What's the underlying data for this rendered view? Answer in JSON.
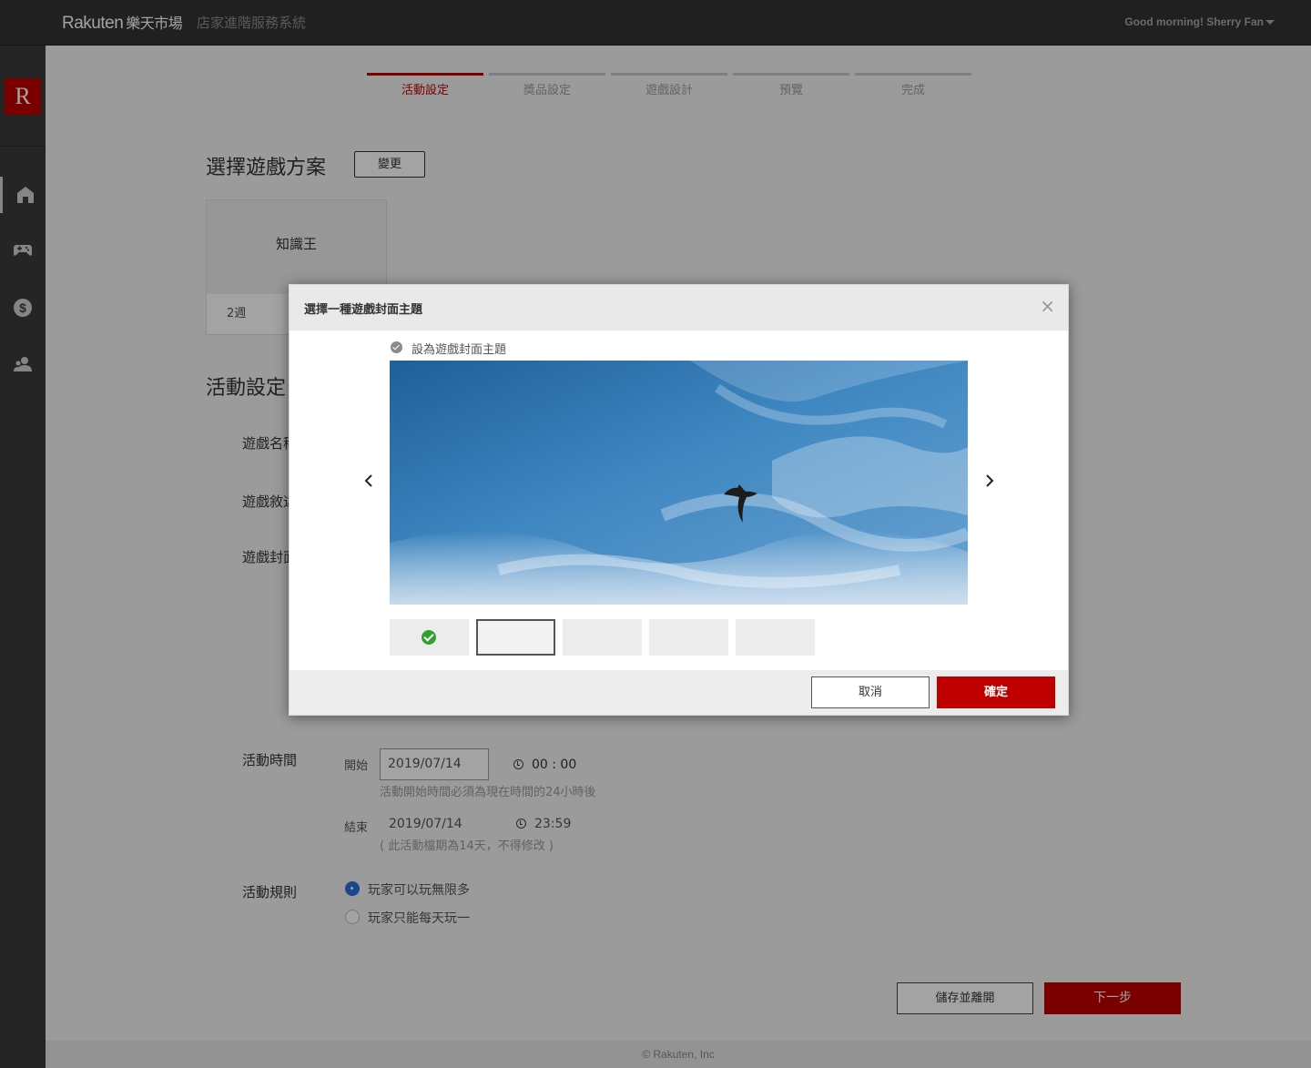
{
  "header": {
    "brand": "Rakuten",
    "market": "樂天市場",
    "system_title": "店家進階服務系統",
    "greeting": "Good morning!  Sherry Fan"
  },
  "sidebar": {
    "logo": "R",
    "items": [
      {
        "icon": "store-icon",
        "active": true
      },
      {
        "icon": "gamepad-icon",
        "active": false
      },
      {
        "icon": "dollar-icon",
        "active": false
      },
      {
        "icon": "users-icon",
        "active": false
      }
    ]
  },
  "steps": [
    "活動設定",
    "獎品設定",
    "遊戲設計",
    "預覽",
    "完成"
  ],
  "plan_section": {
    "title": "選擇遊戲方案",
    "change_button": "變更",
    "card_name": "知識王",
    "card_duration": "2週"
  },
  "activity_section": {
    "title": "活動設定",
    "game_name_label": "遊戲名稱",
    "game_desc_label": "遊戲敘述",
    "game_cover_label": "遊戲封面",
    "time_label": "活動時間",
    "start_label": "開始",
    "start_date": "2019/07/14",
    "start_time": "00 : 00",
    "start_hint": "活動開始時間必須為現在時間的24小時後",
    "end_label": "結束",
    "end_date": "2019/07/14",
    "end_time": "23:59",
    "end_hint": "( 此活動檔期為14天，不得修改 )",
    "rules_label": "活動規則",
    "rule_options": [
      "玩家可以玩無限多",
      "玩家只能每天玩一"
    ],
    "rule_selected": 0
  },
  "actions": {
    "save_exit": "儲存並離開",
    "next": "下一步"
  },
  "footer": "© Rakuten, Inc",
  "modal": {
    "title": "選擇一種遊戲封面主題",
    "close": "×",
    "caption": "設為遊戲封面主題",
    "thumbnail_count": 5,
    "checked_thumbnail": 1,
    "selected_thumbnail": 2,
    "cancel": "取消",
    "confirm": "確定"
  },
  "colors": {
    "brand_red": "#bf0000",
    "topbar": "#333333",
    "sidebar": "#3b3b3b",
    "radio_selected": "#2c6edc",
    "check_green": "#2ea12e"
  }
}
